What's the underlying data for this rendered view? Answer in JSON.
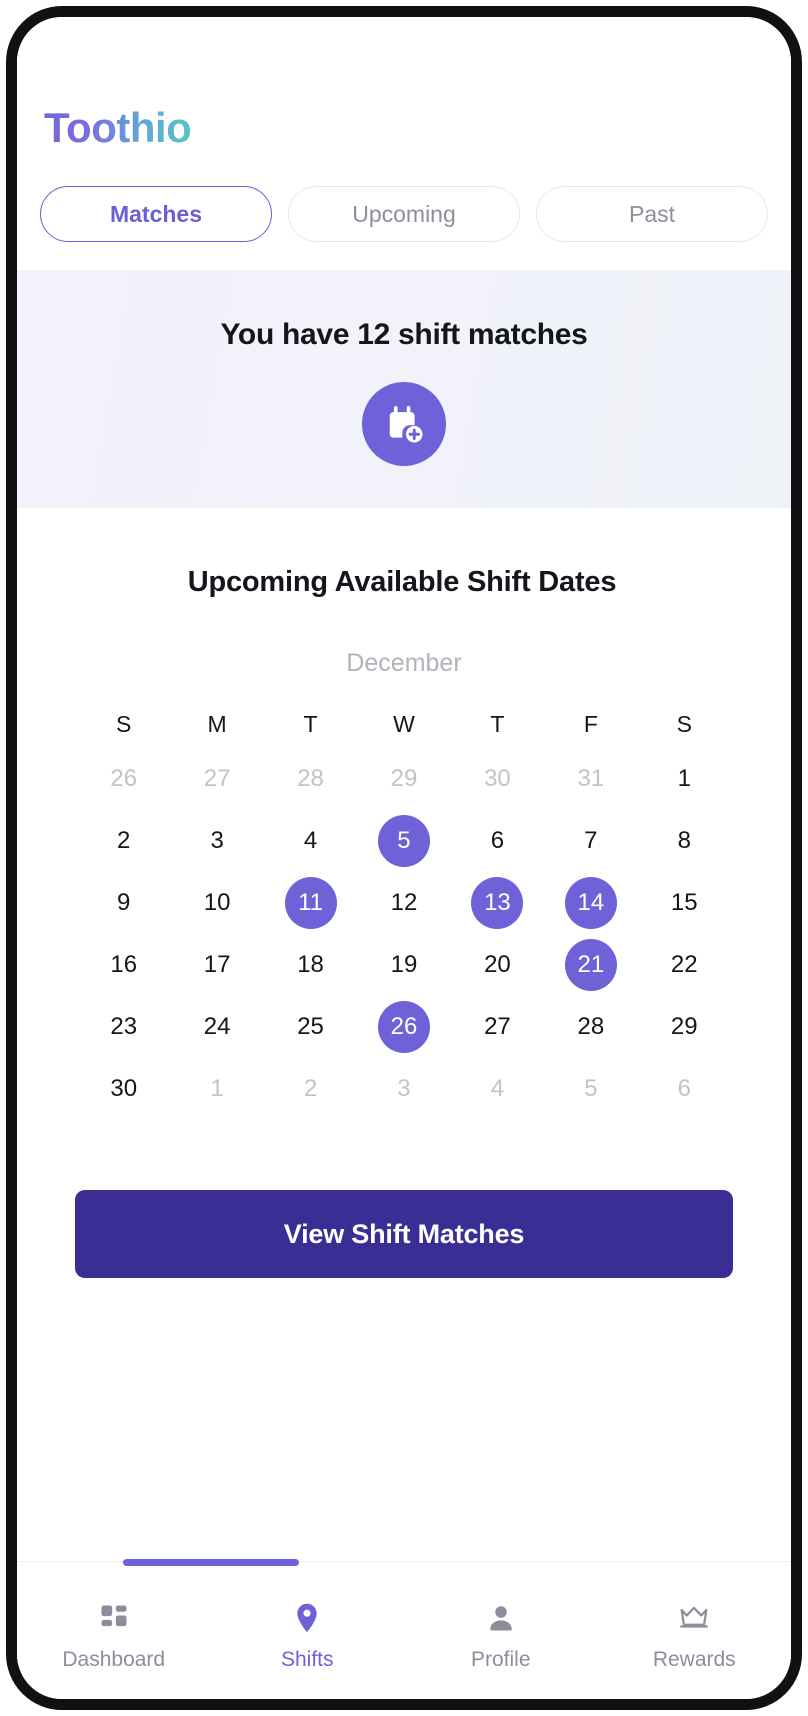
{
  "app": {
    "logo_text": "Toothio",
    "brand_purple": "#6F61D8",
    "brand_teal": "#55C6C4",
    "cta_purple": "#3A2E94"
  },
  "tabs": [
    {
      "label": "Matches",
      "active": true
    },
    {
      "label": "Upcoming",
      "active": false
    },
    {
      "label": "Past",
      "active": false
    }
  ],
  "banner": {
    "title": "You have 12 shift matches",
    "match_count": "12",
    "icon": "calendar-plus-icon"
  },
  "calendar": {
    "heading": "Upcoming Available Shift Dates",
    "month": "December",
    "weekdays": [
      "S",
      "M",
      "T",
      "W",
      "T",
      "F",
      "S"
    ],
    "weeks": [
      [
        {
          "d": "26",
          "muted": true,
          "sel": false
        },
        {
          "d": "27",
          "muted": true,
          "sel": false
        },
        {
          "d": "28",
          "muted": true,
          "sel": false
        },
        {
          "d": "29",
          "muted": true,
          "sel": false
        },
        {
          "d": "30",
          "muted": true,
          "sel": false
        },
        {
          "d": "31",
          "muted": true,
          "sel": false
        },
        {
          "d": "1",
          "muted": false,
          "sel": false
        }
      ],
      [
        {
          "d": "2",
          "muted": false,
          "sel": false
        },
        {
          "d": "3",
          "muted": false,
          "sel": false
        },
        {
          "d": "4",
          "muted": false,
          "sel": false
        },
        {
          "d": "5",
          "muted": false,
          "sel": true
        },
        {
          "d": "6",
          "muted": false,
          "sel": false
        },
        {
          "d": "7",
          "muted": false,
          "sel": false
        },
        {
          "d": "8",
          "muted": false,
          "sel": false
        }
      ],
      [
        {
          "d": "9",
          "muted": false,
          "sel": false
        },
        {
          "d": "10",
          "muted": false,
          "sel": false
        },
        {
          "d": "11",
          "muted": false,
          "sel": true
        },
        {
          "d": "12",
          "muted": false,
          "sel": false
        },
        {
          "d": "13",
          "muted": false,
          "sel": true
        },
        {
          "d": "14",
          "muted": false,
          "sel": true
        },
        {
          "d": "15",
          "muted": false,
          "sel": false
        }
      ],
      [
        {
          "d": "16",
          "muted": false,
          "sel": false
        },
        {
          "d": "17",
          "muted": false,
          "sel": false
        },
        {
          "d": "18",
          "muted": false,
          "sel": false
        },
        {
          "d": "19",
          "muted": false,
          "sel": false
        },
        {
          "d": "20",
          "muted": false,
          "sel": false
        },
        {
          "d": "21",
          "muted": false,
          "sel": true
        },
        {
          "d": "22",
          "muted": false,
          "sel": false
        }
      ],
      [
        {
          "d": "23",
          "muted": false,
          "sel": false
        },
        {
          "d": "24",
          "muted": false,
          "sel": false
        },
        {
          "d": "25",
          "muted": false,
          "sel": false
        },
        {
          "d": "26",
          "muted": false,
          "sel": true
        },
        {
          "d": "27",
          "muted": false,
          "sel": false
        },
        {
          "d": "28",
          "muted": false,
          "sel": false
        },
        {
          "d": "29",
          "muted": false,
          "sel": false
        }
      ],
      [
        {
          "d": "30",
          "muted": false,
          "sel": false
        },
        {
          "d": "1",
          "muted": true,
          "sel": false
        },
        {
          "d": "2",
          "muted": true,
          "sel": false
        },
        {
          "d": "3",
          "muted": true,
          "sel": false
        },
        {
          "d": "4",
          "muted": true,
          "sel": false
        },
        {
          "d": "5",
          "muted": true,
          "sel": false
        },
        {
          "d": "6",
          "muted": true,
          "sel": false
        }
      ]
    ],
    "selected_days": [
      "5",
      "11",
      "13",
      "14",
      "21",
      "26"
    ]
  },
  "cta": {
    "label": "View Shift Matches"
  },
  "bottom_nav": {
    "items": [
      {
        "label": "Dashboard",
        "icon": "grid-icon",
        "active": false
      },
      {
        "label": "Shifts",
        "icon": "location-pin-icon",
        "active": true
      },
      {
        "label": "Profile",
        "icon": "person-icon",
        "active": false
      },
      {
        "label": "Rewards",
        "icon": "crown-icon",
        "active": false
      }
    ]
  }
}
